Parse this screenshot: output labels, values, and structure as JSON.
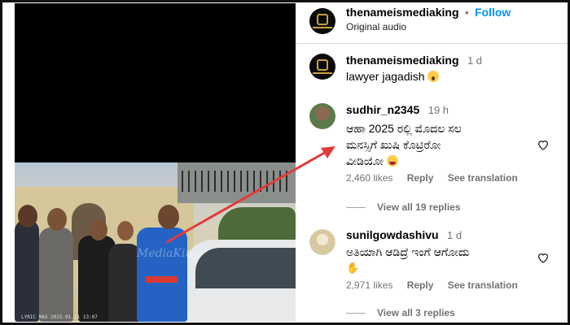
{
  "post": {
    "username": "thenameismediaking",
    "separator": "•",
    "follow_label": "Follow",
    "audio": "Original audio"
  },
  "video": {
    "timestamp_overlay": "LYRIC MAX 2025.01.21 13:07",
    "watermark": "MediaKing"
  },
  "caption": {
    "username": "thenameismediaking",
    "time": "1 d",
    "text": "lawyer jagadish",
    "emoji": "shocked-face-emoji"
  },
  "comments": [
    {
      "username": "sudhir_n2345",
      "time": "19 h",
      "text_line1": "ಆಹಾ 2025 ರಲ್ಲಿ ಮೊದಲ ಸಲ",
      "text_line2": "ಮನಸ್ಸಿಗೆ ಖುಷಿ ಕೊಟ್ರಿರೋ",
      "text_line3": "ವೀಡಿಯೋ",
      "emoji": "laughing-face-emoji",
      "likes": "2,460 likes",
      "reply": "Reply",
      "translate": "See translation",
      "view_replies": "View all 19 replies"
    },
    {
      "username": "sunilgowdashivu",
      "time": "1 d",
      "text_line1": "ಅತಿಯಾಗಿ ಆಡಿದ್ರೆ ಇಂಗೆ ಆಗೋದು",
      "emoji": "ok-hand-emoji",
      "likes": "2,971 likes",
      "reply": "Reply",
      "translate": "See translation",
      "view_replies": "View all 3 replies"
    }
  ],
  "colors": {
    "follow": "#0095f6",
    "muted": "#737373",
    "arrow": "#e23b3b",
    "divider": "#dbdbdb"
  }
}
